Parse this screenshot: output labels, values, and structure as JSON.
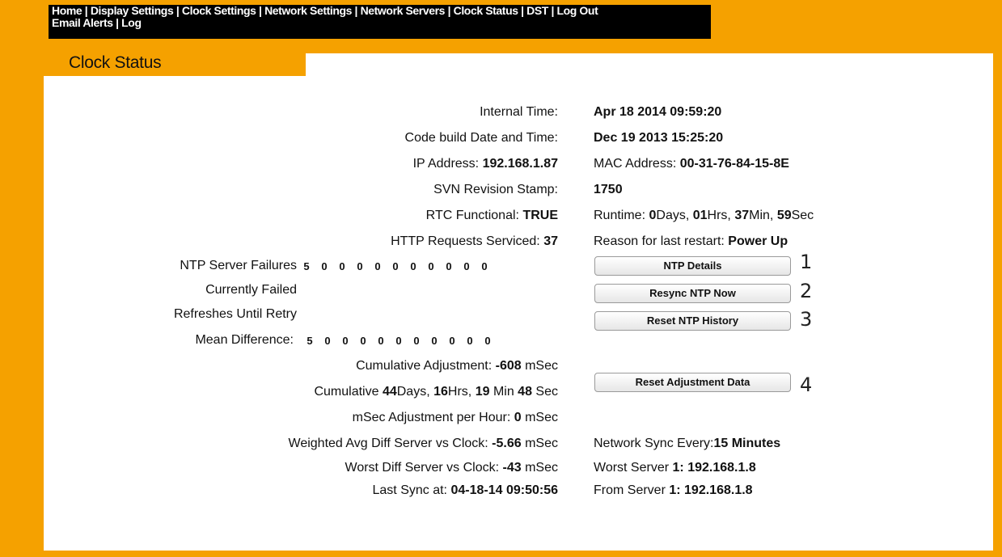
{
  "nav": {
    "row1": [
      "Home",
      "Display Settings",
      "Clock Settings",
      "Network Settings",
      "Network Servers",
      "Clock Status",
      "DST",
      "Log Out"
    ],
    "row2": [
      "Email Alerts",
      "Log"
    ],
    "separator": "|"
  },
  "page_title": "Clock Status",
  "status": {
    "internal_time_label": "Internal Time:",
    "internal_time_value": "Apr 18 2014 09:59:20",
    "code_build_label": "Code build Date and Time:",
    "code_build_value": "Dec 19 2013 15:25:20",
    "ip_label": "IP Address:",
    "ip_value": "192.168.1.87",
    "mac_label": "MAC Address:",
    "mac_value": "00-31-76-84-15-8E",
    "svn_label": "SVN Revision Stamp:",
    "svn_value": "1750",
    "rtc_label": "RTC Functional:",
    "rtc_value": "TRUE",
    "runtime_label": "Runtime:",
    "runtime_days": "0",
    "runtime_days_unit": "Days,",
    "runtime_hrs": "01",
    "runtime_hrs_unit": "Hrs,",
    "runtime_min": "37",
    "runtime_min_unit": "Min,",
    "runtime_sec": "59",
    "runtime_sec_unit": "Sec",
    "http_label": "HTTP Requests Serviced:",
    "http_value": "37",
    "restart_label": "Reason for last restart:",
    "restart_value": "Power Up",
    "ntp_failures_label": "NTP Server Failures",
    "ntp_failures_values": [
      "5",
      "0",
      "0",
      "0",
      "0",
      "0",
      "0",
      "0",
      "0",
      "0",
      "0"
    ],
    "currently_failed_label": "Currently Failed",
    "refreshes_label": "Refreshes Until Retry",
    "mean_diff_label": "Mean Difference:",
    "mean_diff_values": [
      "5",
      "0",
      "0",
      "0",
      "0",
      "0",
      "0",
      "0",
      "0",
      "0",
      "0"
    ],
    "cum_adj_label": "Cumulative Adjustment:",
    "cum_adj_value": "-608",
    "cum_adj_unit": "mSec",
    "cumulative_label": "Cumulative",
    "cum_days": "44",
    "cum_days_unit": "Days,",
    "cum_hrs": "16",
    "cum_hrs_unit": "Hrs,",
    "cum_min": "19",
    "cum_min_unit": "Min",
    "cum_sec": "48",
    "cum_sec_unit": "Sec",
    "msec_per_hour_label": "mSec Adjustment per Hour:",
    "msec_per_hour_value": "0",
    "msec_per_hour_unit": "mSec",
    "weighted_label": "Weighted Avg Diff Server vs Clock:",
    "weighted_value": "-5.66",
    "weighted_unit": "mSec",
    "sync_every_label": "Network Sync Every:",
    "sync_every_value": "15 Minutes",
    "worst_diff_label": "Worst Diff Server vs Clock:",
    "worst_diff_value": "-43",
    "worst_diff_unit": "mSec",
    "worst_server_label": "Worst Server",
    "worst_server_value": "1: 192.168.1.8",
    "last_sync_label": "Last Sync at:",
    "last_sync_value": "04-18-14 09:50:56",
    "from_server_label": "From Server",
    "from_server_value": "1: 192.168.1.8"
  },
  "buttons": {
    "ntp_details": "NTP Details",
    "resync": "Resync NTP Now",
    "reset_history": "Reset NTP History",
    "reset_adjustment": "Reset Adjustment Data"
  },
  "callouts": [
    "1",
    "2",
    "3",
    "4"
  ],
  "colors": {
    "frame": "#f5a100",
    "nav_bg": "#000000",
    "panel": "#ffffff"
  }
}
